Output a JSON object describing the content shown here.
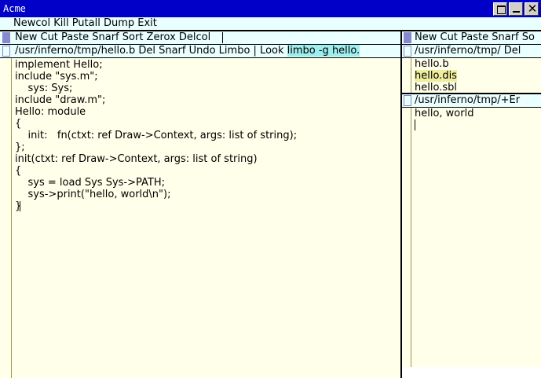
{
  "window": {
    "title": "Acme"
  },
  "main_tag": "Newcol Kill Putall Dump Exit",
  "left_column": {
    "tag": "New Cut Paste Snarf Sort Zerox Delcol",
    "window": {
      "tag_before": "/usr/inferno/tmp/hello.b Del Snarf Undo Limbo | Look ",
      "tag_selected": "limbo -g hello.",
      "lines": [
        "implement Hello;",
        "",
        "include \"sys.m\";",
        "    sys: Sys;",
        "",
        "include \"draw.m\";",
        "",
        "Hello: module",
        "{",
        "    init:   fn(ctxt: ref Draw->Context, args: list of string);",
        "};",
        "",
        "init(ctxt: ref Draw->Context, args: list of string)",
        "{",
        "    sys = load Sys Sys->PATH;",
        "    sys->print(\"hello, world\\n\");",
        "}"
      ]
    }
  },
  "right_column": {
    "tag": "New Cut Paste Snarf So",
    "dir_window": {
      "tag": "/usr/inferno/tmp/ Del",
      "files": [
        "hello.b",
        "hello.dis",
        "hello.sbl"
      ],
      "selected_index": 1
    },
    "output_window": {
      "tag": "/usr/inferno/tmp/+Er",
      "lines": [
        "hello, world"
      ]
    }
  },
  "colors": {
    "titlebar": "#0000c8",
    "tag_bg": "#eaffff",
    "body_bg": "#ffffea",
    "square": "#8888cc",
    "highlight": "#eeee9e",
    "tag_highlight": "#9eeeee"
  },
  "icons": [
    "maximize-icon",
    "minimize-icon",
    "close-icon"
  ]
}
